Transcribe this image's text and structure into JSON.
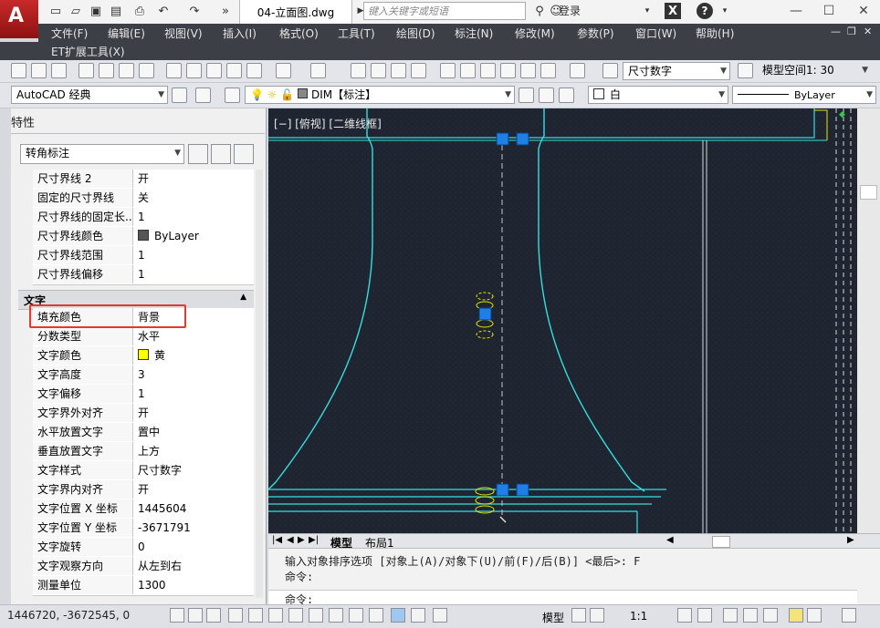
{
  "title_bar": {
    "app_letter": "A",
    "document_tab": "04-立面图.dwg",
    "search_placeholder": "键入关键字或短语",
    "login_label": "登录",
    "help_label": "?"
  },
  "menu": {
    "items": [
      "文件(F)",
      "编辑(E)",
      "视图(V)",
      "插入(I)",
      "格式(O)",
      "工具(T)",
      "绘图(D)",
      "标注(N)",
      "修改(M)",
      "参数(P)",
      "窗口(W)",
      "帮助(H)"
    ],
    "second_row": [
      "ET扩展工具(X)"
    ]
  },
  "toolbar": {
    "dim_style": "尺寸数字",
    "space_label": "模型空间1: 30"
  },
  "toolbar2": {
    "workspace": "AutoCAD 经典",
    "layer": "DIM【标注】",
    "color": "白",
    "linetype": "ByLayer"
  },
  "properties": {
    "title": "特性",
    "object_type": "转角标注",
    "rows_top": [
      {
        "key": "尺寸界线 2",
        "value": "开"
      },
      {
        "key": "固定的尺寸界线",
        "value": "关"
      },
      {
        "key": "尺寸界线的固定长...",
        "value": "1"
      },
      {
        "key": "尺寸界线颜色",
        "value": "ByLayer",
        "swatch": "#555555"
      },
      {
        "key": "尺寸界线范围",
        "value": "1"
      },
      {
        "key": "尺寸界线偏移",
        "value": "1"
      }
    ],
    "section": "文字",
    "rows_text": [
      {
        "key": "填充颜色",
        "value": "背景"
      },
      {
        "key": "分数类型",
        "value": "水平"
      },
      {
        "key": "文字颜色",
        "value": "黄",
        "swatch": "#ffff00"
      },
      {
        "key": "文字高度",
        "value": "3"
      },
      {
        "key": "文字偏移",
        "value": "1"
      },
      {
        "key": "文字界外对齐",
        "value": "开"
      },
      {
        "key": "水平放置文字",
        "value": "置中"
      },
      {
        "key": "垂直放置文字",
        "value": "上方"
      },
      {
        "key": "文字样式",
        "value": "尺寸数字"
      },
      {
        "key": "文字界内对齐",
        "value": "开"
      },
      {
        "key": "文字位置 X 坐标",
        "value": "1445604"
      },
      {
        "key": "文字位置 Y 坐标",
        "value": "-3671791"
      },
      {
        "key": "文字旋转",
        "value": "0"
      },
      {
        "key": "文字观察方向",
        "value": "从左到右"
      },
      {
        "key": "测量单位",
        "value": "1300"
      }
    ]
  },
  "viewport": {
    "label": "[−] [俯视] [二维线框]"
  },
  "layout_tabs": [
    "模型",
    "布局1"
  ],
  "command": {
    "history1": "输入对象排序选项 [对象上(A)/对象下(U)/前(F)/后(B)] <最后>: F",
    "history2": "命令:",
    "prompt": "命令:"
  },
  "status": {
    "coords": "1446720, -3672545, 0",
    "model_label": "模型",
    "scale": "1:1"
  }
}
